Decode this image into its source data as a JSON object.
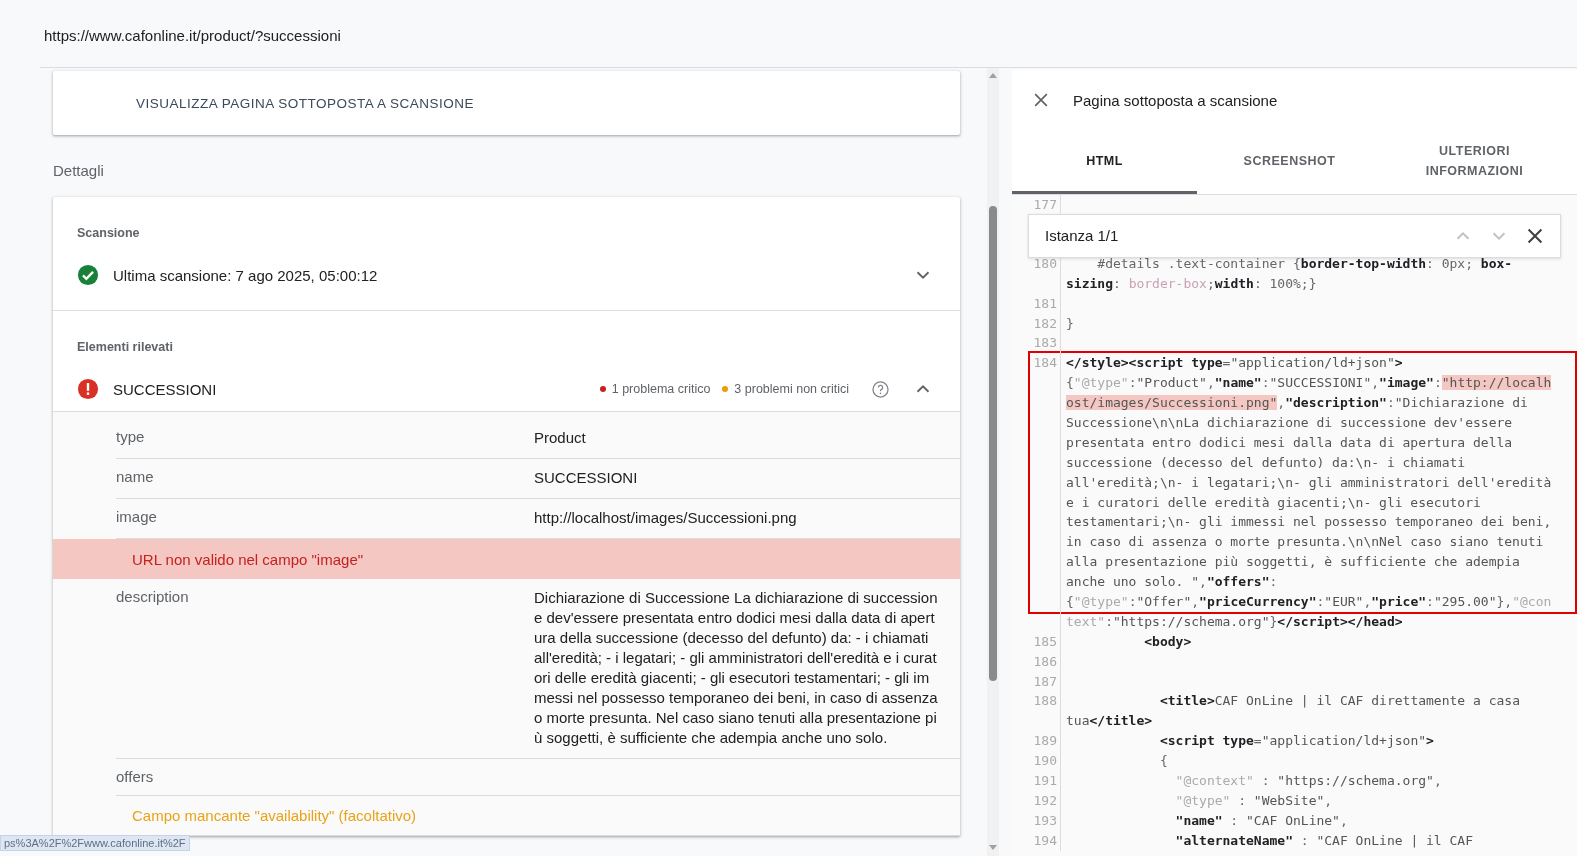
{
  "address_bar": {
    "url": "https://www.cafonline.it/product/?successioni"
  },
  "inspect_card": {
    "button": "VISUALIZZA PAGINA SOTTOPOSTA A SCANSIONE"
  },
  "details_heading": "Dettagli",
  "crawl": {
    "heading": "Scansione",
    "text": "Ultima scansione: 7 ago 2025, 05:00:12",
    "expanded": false
  },
  "detected": {
    "heading": "Elementi rilevati",
    "name": "SUCCESSIONI",
    "critical": "1 problema critico",
    "noncritical": "3 problemi non critici",
    "expanded": true,
    "fields": [
      {
        "kind": "field",
        "label": "type",
        "value": "Product"
      },
      {
        "kind": "field",
        "label": "name",
        "value": "SUCCESSIONI"
      },
      {
        "kind": "field",
        "label": "image",
        "value": "http://localhost/images/Successioni.png"
      },
      {
        "kind": "error",
        "text": "URL non valido nel campo \"image\""
      },
      {
        "kind": "field",
        "label": "description",
        "value": "Dichiarazione di Successione La dichiarazione di successione dev'essere presentata entro dodici mesi dalla data di apertura della successione (decesso del defunto) da: - i chiamati all'eredità; - i legatari; - gli amministratori dell'eredità e i curatori delle eredità giacenti; - gli esecutori testamentari; - gli immessi nel possesso temporaneo dei beni, in caso di assenza o morte presunta. Nel caso siano tenuti alla presentazione più soggetti, è sufficiente che adempia anche uno solo."
      },
      {
        "kind": "field",
        "label": "offers"
      },
      {
        "kind": "warning",
        "text": "Campo mancante \"availability\" (facoltativo)"
      }
    ]
  },
  "status_tooltip": "ps%3A%2F%2Fwww.cafonline.it%2F",
  "panel": {
    "title": "Pagina sottoposta a scansione",
    "tabs": [
      {
        "label": "HTML",
        "selected": true
      },
      {
        "label": "SCREENSHOT",
        "selected": false
      },
      {
        "label": "ULTERIORI INFORMAZIONI",
        "selected": false
      }
    ],
    "code_rows": [
      {
        "kind": "line",
        "number": "177"
      },
      {
        "kind": "search",
        "value": "Istanza 1/1"
      },
      {
        "kind": "line",
        "number": "180",
        "segments": [
          {
            "kind": "plain",
            "text": "    #details .text-container {"
          },
          {
            "kind": "key",
            "text": "border-top-width"
          },
          {
            "kind": "plain",
            "text": ": 0px; "
          },
          {
            "kind": "key",
            "text": "box-"
          }
        ]
      },
      {
        "kind": "line",
        "segments": [
          {
            "kind": "key",
            "text": "sizing"
          },
          {
            "kind": "plain",
            "text": ": "
          },
          {
            "kind": "pink",
            "text": "border-box"
          },
          {
            "kind": "plain",
            "text": ";"
          },
          {
            "kind": "key",
            "text": "width"
          },
          {
            "kind": "plain",
            "text": ": 100%;}"
          }
        ]
      },
      {
        "kind": "line",
        "number": "181"
      },
      {
        "kind": "line",
        "number": "182",
        "segments": [
          {
            "kind": "plain",
            "text": "}"
          }
        ]
      },
      {
        "kind": "line",
        "number": "183"
      },
      {
        "kind": "highlight_block",
        "rows": [
          {
            "number": "184",
            "segments": [
              {
                "kind": "tag",
                "text": "</style><script type"
              },
              {
                "kind": "plain",
                "text": "="
              },
              {
                "kind": "str",
                "text": "\"application/ld+json\""
              },
              {
                "kind": "tag",
                "text": ">"
              }
            ]
          },
          {
            "segments": [
              {
                "kind": "plain",
                "text": "{"
              },
              {
                "kind": "meta",
                "text": "\"@type\""
              },
              {
                "kind": "plain",
                "text": ":"
              },
              {
                "kind": "str",
                "text": "\"Product\""
              },
              {
                "kind": "plain",
                "text": ","
              },
              {
                "kind": "key",
                "text": "\"name\""
              },
              {
                "kind": "plain",
                "text": ":"
              },
              {
                "kind": "str",
                "text": "\"SUCCESSIONI\""
              },
              {
                "kind": "plain",
                "text": ","
              },
              {
                "kind": "key",
                "text": "\"image\""
              },
              {
                "kind": "plain",
                "text": ":"
              },
              {
                "kind": "error",
                "text": "\"http://localh"
              }
            ]
          },
          {
            "segments": [
              {
                "kind": "error",
                "text": "ost/images/Successioni.png\""
              },
              {
                "kind": "plain",
                "text": ","
              },
              {
                "kind": "key",
                "text": "\"description\""
              },
              {
                "kind": "plain",
                "text": ":"
              },
              {
                "kind": "str",
                "text": "\"Dichiarazione di"
              }
            ]
          },
          {
            "segments": [
              {
                "kind": "str",
                "text": "Successione\\n\\nLa dichiarazione di successione dev'essere"
              }
            ]
          },
          {
            "segments": [
              {
                "kind": "str",
                "text": "presentata entro dodici mesi dalla data di apertura della"
              }
            ]
          },
          {
            "segments": [
              {
                "kind": "str",
                "text": "successione (decesso del defunto) da:\\n- i chiamati"
              }
            ]
          },
          {
            "segments": [
              {
                "kind": "str",
                "text": "all'eredità;\\n- i legatari;\\n- gli amministratori dell'eredità"
              }
            ]
          },
          {
            "segments": [
              {
                "kind": "str",
                "text": "e i curatori delle eredità giacenti;\\n- gli esecutori"
              }
            ]
          },
          {
            "segments": [
              {
                "kind": "str",
                "text": "testamentari;\\n- gli immessi nel possesso temporaneo dei beni,"
              }
            ]
          },
          {
            "segments": [
              {
                "kind": "str",
                "text": "in caso di assenza o morte presunta.\\n\\nNel caso siano tenuti"
              }
            ]
          },
          {
            "segments": [
              {
                "kind": "str",
                "text": "alla presentazione più soggetti, è sufficiente che adempia"
              }
            ]
          },
          {
            "segments": [
              {
                "kind": "str",
                "text": "anche uno solo. \""
              },
              {
                "kind": "plain",
                "text": ","
              },
              {
                "kind": "key",
                "text": "\"offers\""
              },
              {
                "kind": "plain",
                "text": ":"
              }
            ]
          },
          {
            "segments": [
              {
                "kind": "plain",
                "text": "{"
              },
              {
                "kind": "meta",
                "text": "\"@type\""
              },
              {
                "kind": "plain",
                "text": ":"
              },
              {
                "kind": "str",
                "text": "\"Offer\""
              },
              {
                "kind": "plain",
                "text": ","
              },
              {
                "kind": "key",
                "text": "\"priceCurrency\""
              },
              {
                "kind": "plain",
                "text": ":"
              },
              {
                "kind": "str",
                "text": "\"EUR\""
              },
              {
                "kind": "plain",
                "text": ","
              },
              {
                "kind": "key",
                "text": "\"price\""
              },
              {
                "kind": "plain",
                "text": ":"
              },
              {
                "kind": "str",
                "text": "\"295.00\""
              },
              {
                "kind": "plain",
                "text": "},"
              },
              {
                "kind": "meta",
                "text": "\"@con"
              }
            ]
          }
        ]
      },
      {
        "kind": "line",
        "segments": [
          {
            "kind": "meta",
            "text": "text\""
          },
          {
            "kind": "plain",
            "text": ":"
          },
          {
            "kind": "str",
            "text": "\"https://schema.org\""
          },
          {
            "kind": "plain",
            "text": "}"
          },
          {
            "kind": "tag",
            "text": "</script></head>"
          }
        ]
      },
      {
        "kind": "line",
        "number": "185",
        "segments": [
          {
            "kind": "tag",
            "text": "          <body>"
          }
        ]
      },
      {
        "kind": "line",
        "number": "186"
      },
      {
        "kind": "line",
        "number": "187"
      },
      {
        "kind": "line",
        "number": "188",
        "segments": [
          {
            "kind": "tag",
            "text": "            <title>"
          },
          {
            "kind": "str",
            "text": "CAF OnLine | il CAF direttamente a casa"
          }
        ]
      },
      {
        "kind": "line",
        "segments": [
          {
            "kind": "str",
            "text": "tua"
          },
          {
            "kind": "tag",
            "text": "</title>"
          }
        ]
      },
      {
        "kind": "line",
        "number": "189",
        "segments": [
          {
            "kind": "tag",
            "text": "            <script type"
          },
          {
            "kind": "plain",
            "text": "="
          },
          {
            "kind": "str",
            "text": "\"application/ld+json\""
          },
          {
            "kind": "tag",
            "text": ">"
          }
        ]
      },
      {
        "kind": "line",
        "number": "190",
        "segments": [
          {
            "kind": "plain",
            "text": "            {"
          }
        ]
      },
      {
        "kind": "line",
        "number": "191",
        "segments": [
          {
            "kind": "meta",
            "text": "              \"@context\""
          },
          {
            "kind": "plain",
            "text": " : "
          },
          {
            "kind": "str",
            "text": "\"https://schema.org\""
          },
          {
            "kind": "plain",
            "text": ","
          }
        ]
      },
      {
        "kind": "line",
        "number": "192",
        "segments": [
          {
            "kind": "meta",
            "text": "              \"@type\""
          },
          {
            "kind": "plain",
            "text": " : "
          },
          {
            "kind": "str",
            "text": "\"WebSite\""
          },
          {
            "kind": "plain",
            "text": ","
          }
        ]
      },
      {
        "kind": "line",
        "number": "193",
        "segments": [
          {
            "kind": "key",
            "text": "              \"name\""
          },
          {
            "kind": "plain",
            "text": " : "
          },
          {
            "kind": "str",
            "text": "\"CAF OnLine\""
          },
          {
            "kind": "plain",
            "text": ","
          }
        ]
      },
      {
        "kind": "line",
        "number": "194",
        "segments": [
          {
            "kind": "key",
            "text": "              \"alternateName\""
          },
          {
            "kind": "plain",
            "text": " : "
          },
          {
            "kind": "str",
            "text": "\"CAF OnLine | il CAF"
          }
        ]
      }
    ]
  }
}
